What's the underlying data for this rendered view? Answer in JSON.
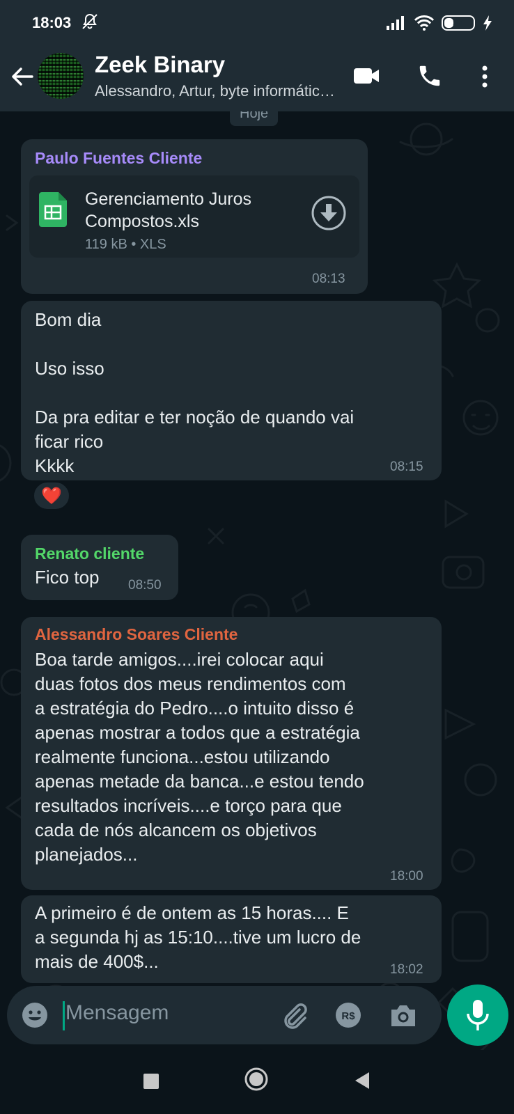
{
  "status_bar": {
    "time": "18:03",
    "battery": "39",
    "battery_level": 0.39,
    "icons": [
      "mute-icon",
      "signal-icon",
      "wifi-icon",
      "battery-icon",
      "charging-icon"
    ]
  },
  "header": {
    "title": "Zeek Binary",
    "subtitle": "Alessandro, Artur, byte informática, Carlos, Paulo",
    "icons": [
      "back-arrow-icon",
      "video-call-icon",
      "phone-call-icon",
      "more-options-icon"
    ]
  },
  "chat": {
    "date_chip": "Hoje",
    "messages": [
      {
        "sender": "Paulo Fuentes Cliente",
        "sender_color": "#a78bfa",
        "document": {
          "name": "Gerenciamento Juros\nCompostos.xls",
          "meta": "119 kB • XLS"
        },
        "time": "08:13"
      },
      {
        "text": "Bom dia\n\nUso isso\n\nDa pra editar e ter noção de quando vai\nficar rico\nKkkk",
        "time": "08:15",
        "reaction": "❤️"
      },
      {
        "sender": "Renato cliente",
        "sender_color": "#53d769",
        "text": "Fico top",
        "time": "08:50"
      },
      {
        "sender": "Alessandro Soares Cliente",
        "sender_color": "#e06540",
        "text": "Boa tarde amigos....irei colocar aqui\nduas fotos dos meus rendimentos com\na estratégia do Pedro....o intuito disso é\napenas mostrar a todos que a estratégia\nrealmente funciona...estou utilizando\napenas metade da banca...e estou tendo\nresultados incríveis....e torço para que\ncada de nós alcancem os objetivos\nplanejados...",
        "time": "18:00"
      },
      {
        "text": "A primeiro é de ontem as 15 horas.... E\na segunda hj as 15:10....tive um lucro de\nmais de 400$...",
        "time": "18:02"
      }
    ]
  },
  "input": {
    "placeholder": "Mensagem",
    "icons": [
      "emoji-icon",
      "attach-icon",
      "payment-icon",
      "camera-icon",
      "mic-icon"
    ],
    "payment_label": "R$"
  },
  "colors": {
    "background": "#0b141a",
    "bar": "#1f2c34",
    "bubble": "#202c33",
    "accent": "#00a884"
  }
}
